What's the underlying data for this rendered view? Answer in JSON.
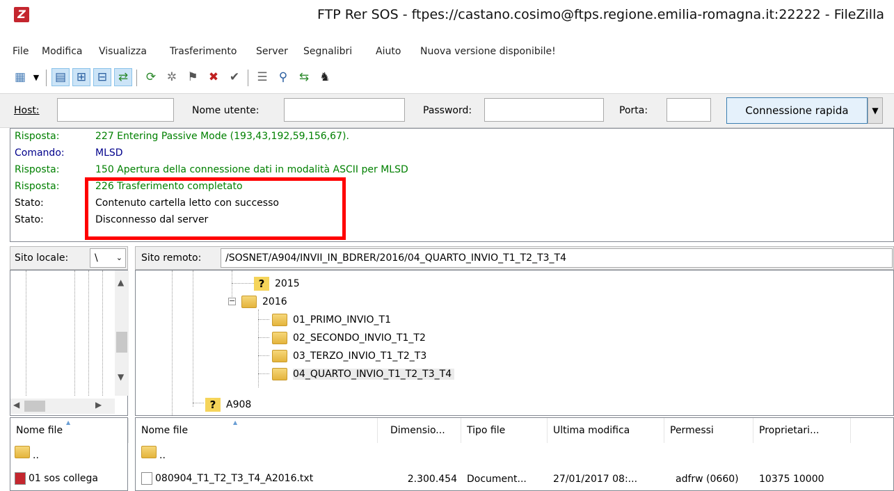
{
  "window": {
    "title": "FTP Rer SOS - ftpes://castano.cosimo@ftps.regione.emilia-romagna.it:22222 - FileZilla",
    "icon": "filezilla-icon"
  },
  "menu": [
    "File",
    "Modifica",
    "Visualizza",
    "Trasferimento",
    "Server",
    "Segnalibri",
    "Aiuto",
    "Nuova versione disponibile!"
  ],
  "quickconnect": {
    "host_label": "Host:",
    "user_label": "Nome utente:",
    "password_label": "Password:",
    "port_label": "Porta:",
    "host_value": "",
    "user_value": "",
    "password_value": "",
    "port_value": "",
    "button": "Connessione rapida"
  },
  "log": [
    {
      "type": "Risposta:",
      "msg": "227 Entering Passive Mode (193,43,192,59,156,67).",
      "kind": "resp"
    },
    {
      "type": "Comando:",
      "msg": "MLSD",
      "kind": "cmd"
    },
    {
      "type": "Risposta:",
      "msg": "150 Apertura della connessione dati in modalità ASCII per MLSD",
      "kind": "resp"
    },
    {
      "type": "Risposta:",
      "msg": "226 Trasferimento completato",
      "kind": "resp"
    },
    {
      "type": "Stato:",
      "msg": "Contenuto cartella letto con successo",
      "kind": "stat"
    },
    {
      "type": "Stato:",
      "msg": "Disconnesso dal server",
      "kind": "stat"
    }
  ],
  "local_site": {
    "label": "Sito locale:",
    "value": "\\"
  },
  "remote_site": {
    "label": "Sito remoto:",
    "value": "/SOSNET/A904/INVII_IN_BDRER/2016/04_QUARTO_INVIO_T1_T2_T3_T4"
  },
  "remote_tree": [
    {
      "name": "2015",
      "icon": "unknown"
    },
    {
      "name": "2016",
      "icon": "folder"
    },
    {
      "name": "01_PRIMO_INVIO_T1",
      "icon": "folder"
    },
    {
      "name": "02_SECONDO_INVIO_T1_T2",
      "icon": "folder"
    },
    {
      "name": "03_TERZO_INVIO_T1_T2_T3",
      "icon": "folder"
    },
    {
      "name": "04_QUARTO_INVIO_T1_T2_T3_T4",
      "icon": "folder"
    },
    {
      "name": "A908",
      "icon": "unknown"
    }
  ],
  "local_list": {
    "header": "Nome file",
    "rows": [
      {
        "name": "..",
        "icon": "folder"
      },
      {
        "name": "01 sos collega",
        "icon": "pdf"
      }
    ]
  },
  "remote_list": {
    "headers": [
      "Nome file",
      "Dimensio...",
      "Tipo file",
      "Ultima modifica",
      "Permessi",
      "Proprietari..."
    ],
    "rows": [
      {
        "name": "..",
        "size": "",
        "type": "",
        "modified": "",
        "perms": "",
        "owner": "",
        "icon": "folder"
      },
      {
        "name": "080904_T1_T2_T3_T4_A2016.txt",
        "size": "2.300.454",
        "type": "Document...",
        "modified": "27/01/2017 08:...",
        "perms": "adfrw (0660)",
        "owner": "10375 10000",
        "icon": "file"
      }
    ]
  }
}
